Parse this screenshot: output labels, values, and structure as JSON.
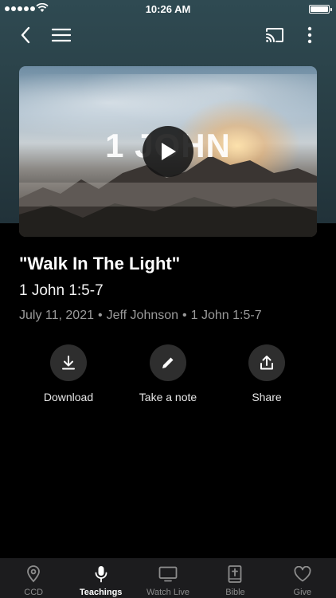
{
  "status_bar": {
    "time": "10:26 AM"
  },
  "colors": {
    "background": "#000000",
    "hero": "#2f4a52",
    "tab_bar": "#1c1c1e",
    "active_tab": "#ffffff",
    "inactive_tab": "#8d8d8d"
  },
  "nav": {
    "back_icon": "chevron-left-icon",
    "menu_icon": "hamburger-menu-icon",
    "cast_icon": "cast-icon",
    "more_icon": "more-vertical-icon"
  },
  "video": {
    "overlay_title": "1 JOHN",
    "play_icon": "play-icon"
  },
  "sermon": {
    "title": "\"Walk In The Light\"",
    "scripture": "1 John 1:5-7",
    "date": "July 11, 2021",
    "speaker": "Jeff Johnson",
    "passage": "1 John 1:5-7",
    "separator": "•"
  },
  "actions": [
    {
      "label": "Download",
      "icon": "download-icon"
    },
    {
      "label": "Take a note",
      "icon": "pencil-icon"
    },
    {
      "label": "Share",
      "icon": "share-icon"
    }
  ],
  "tabs": [
    {
      "label": "CCD",
      "icon": "location-pin-icon",
      "active": false
    },
    {
      "label": "Teachings",
      "icon": "microphone-icon",
      "active": true
    },
    {
      "label": "Watch Live",
      "icon": "tv-icon",
      "active": false
    },
    {
      "label": "Bible",
      "icon": "bible-icon",
      "active": false
    },
    {
      "label": "Give",
      "icon": "heart-icon",
      "active": false
    }
  ]
}
